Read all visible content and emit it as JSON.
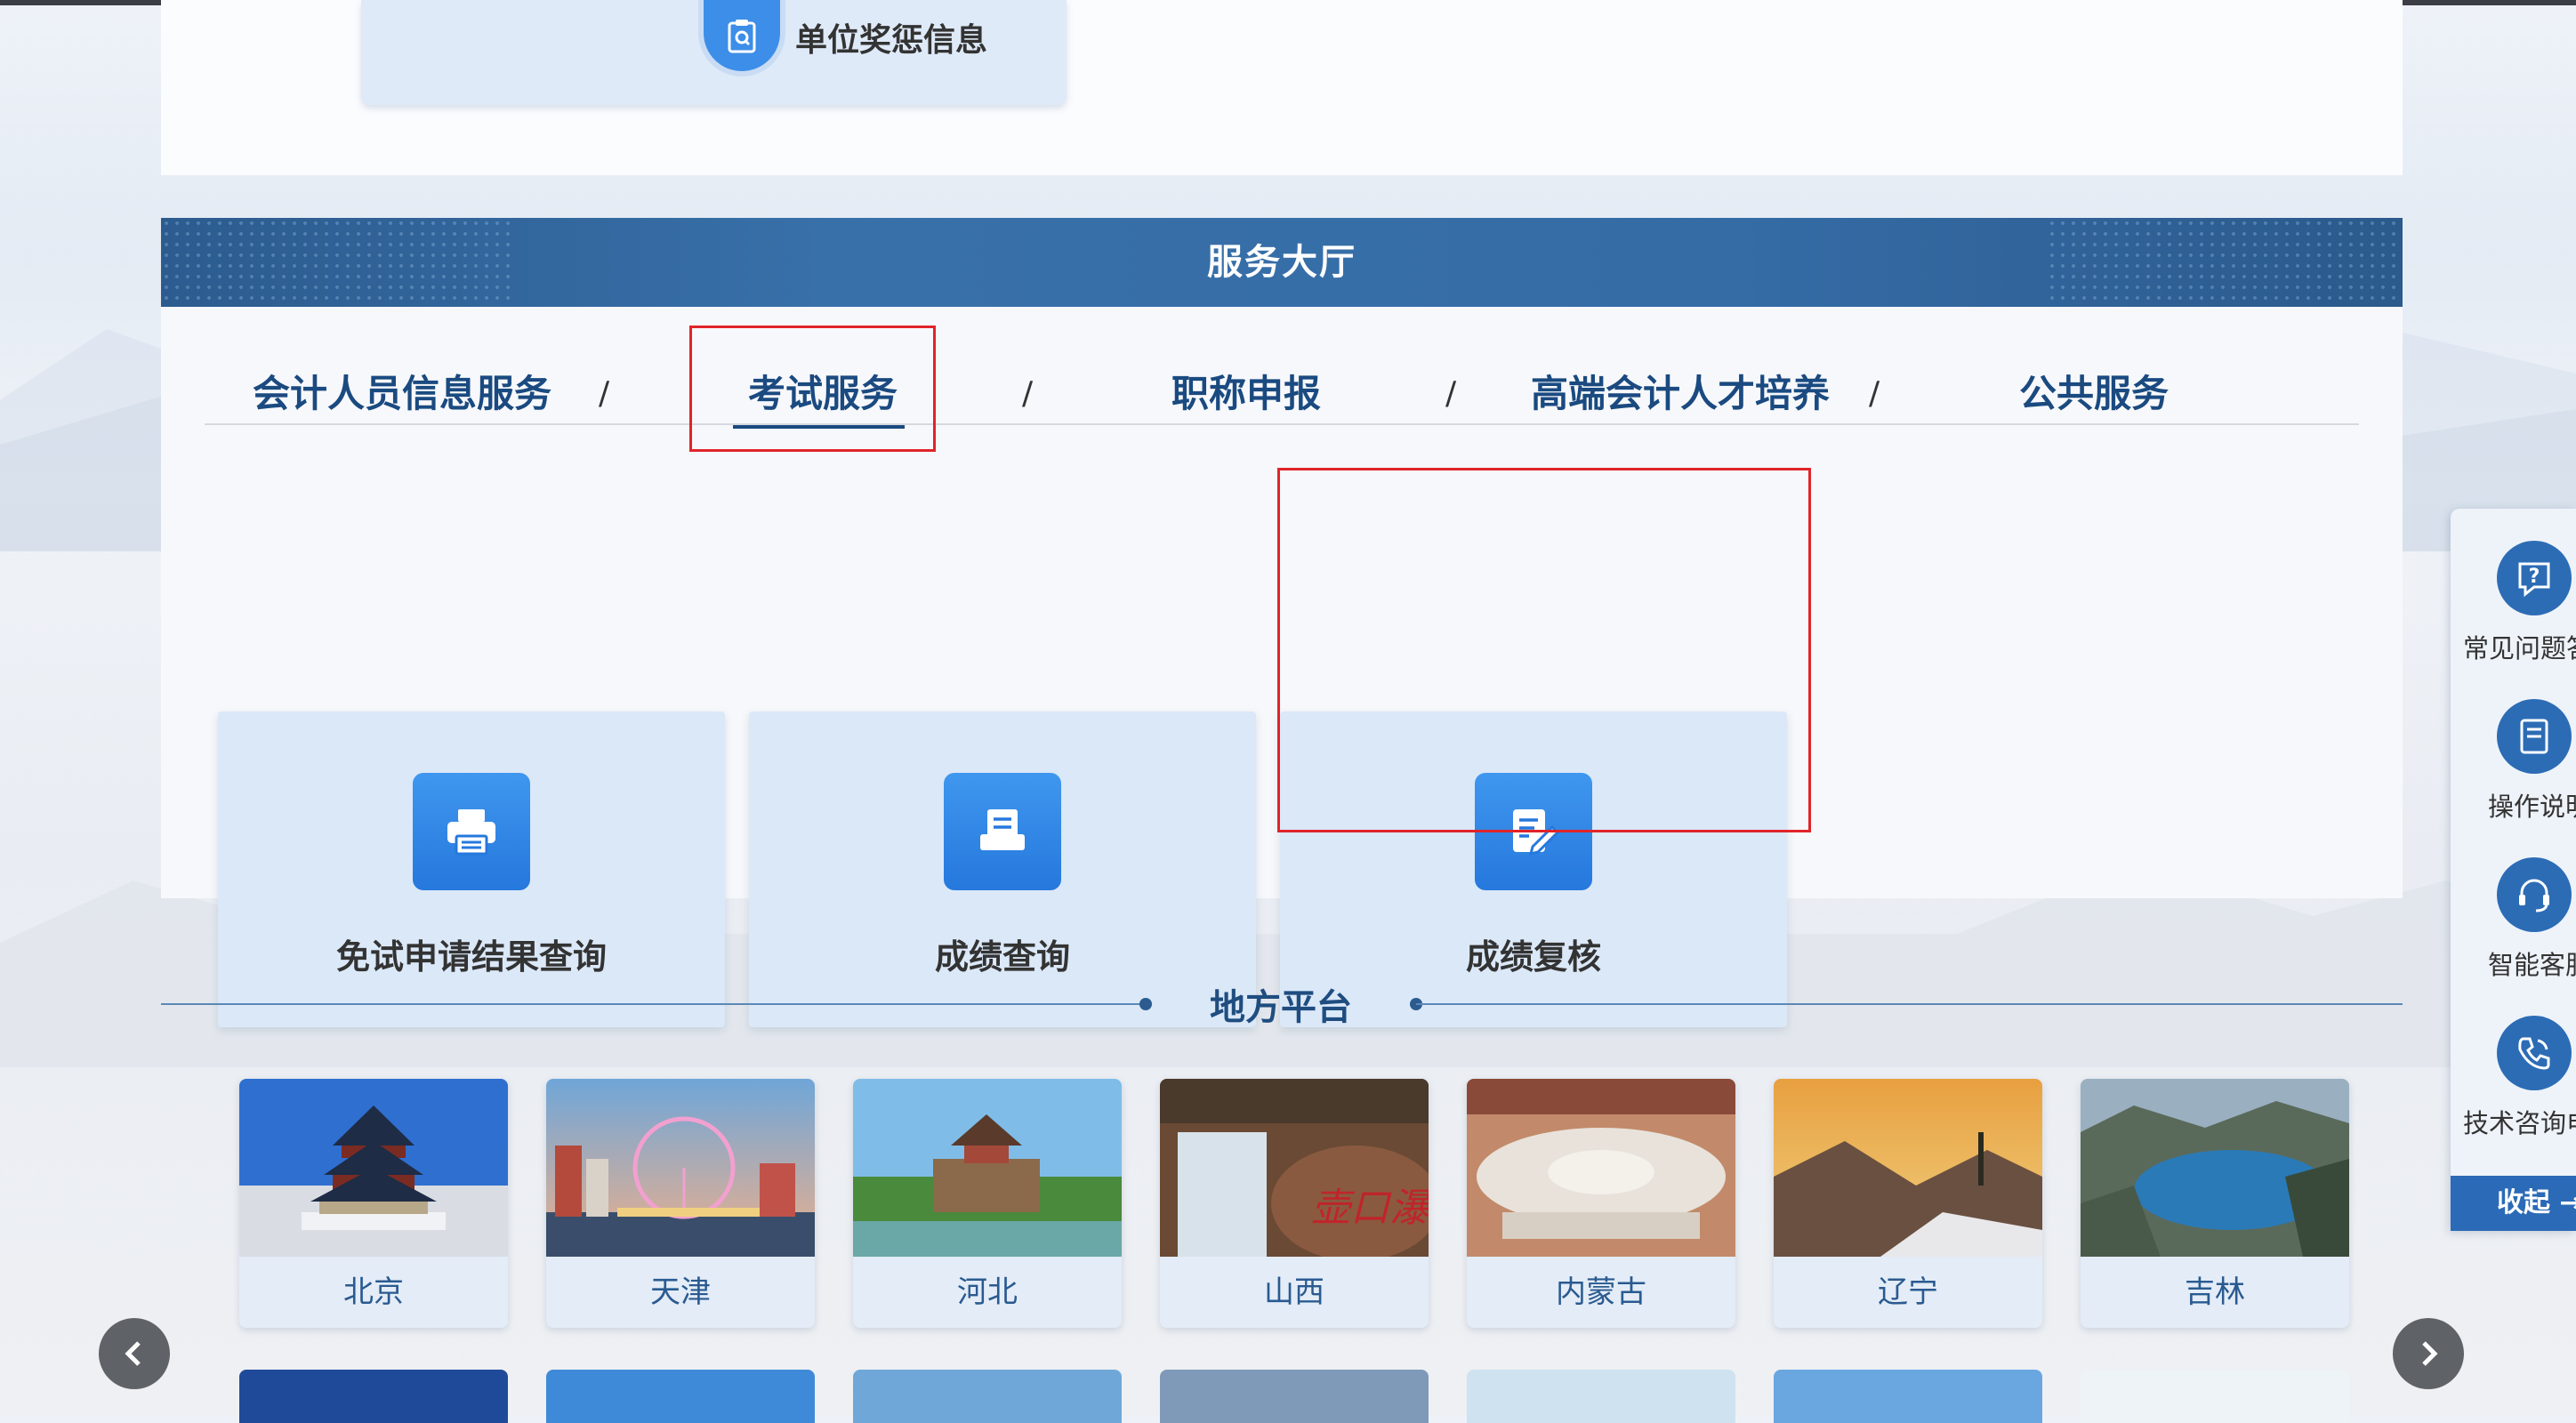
{
  "award": {
    "label": "单位奖惩信息"
  },
  "service": {
    "title": "服务大厅",
    "tabs": [
      {
        "label": "会计人员信息服务"
      },
      {
        "label": "考试服务",
        "active": true
      },
      {
        "label": "职称申报"
      },
      {
        "label": "高端会计人才培养"
      },
      {
        "label": "公共服务"
      }
    ],
    "separator": "/",
    "tiles": [
      {
        "label": "免试申请结果查询",
        "icon": "printer-icon"
      },
      {
        "label": "成绩查询",
        "icon": "document-icon"
      },
      {
        "label": "成绩复核",
        "icon": "edit-document-icon"
      }
    ]
  },
  "local": {
    "title": "地方平台",
    "cities": [
      {
        "name": "北京"
      },
      {
        "name": "天津"
      },
      {
        "name": "河北"
      },
      {
        "name": "山西"
      },
      {
        "name": "内蒙古"
      },
      {
        "name": "辽宁"
      },
      {
        "name": "吉林"
      }
    ]
  },
  "float_panel": {
    "items": [
      {
        "label": "常见问题答",
        "icon": "question-icon"
      },
      {
        "label": "操作说明",
        "icon": "manual-icon"
      },
      {
        "label": "智能客服",
        "icon": "headset-icon"
      },
      {
        "label": "技术咨询电",
        "icon": "phone-icon"
      }
    ],
    "collapse_label": "收起 →"
  },
  "colors": {
    "primary": "#2c5c8f",
    "tile_bg": "#dbe8f8",
    "highlight": "#e0242a",
    "icon_blue": "#2678dd"
  }
}
